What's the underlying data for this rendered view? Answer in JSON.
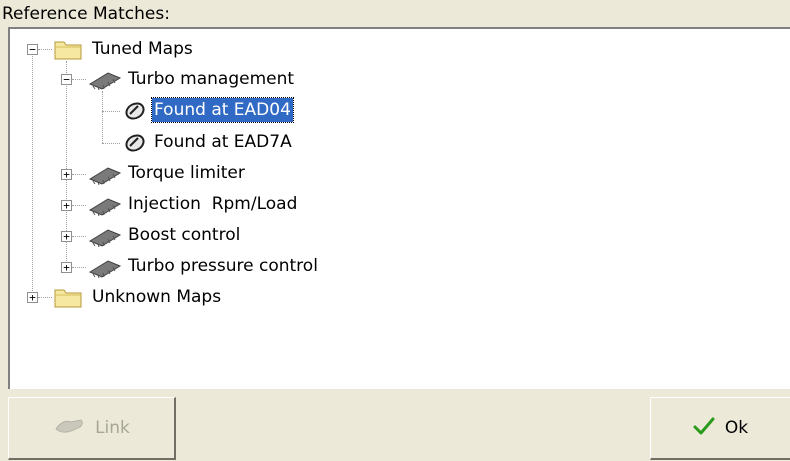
{
  "reference_label": "Reference Matches:",
  "tree": {
    "tuned_maps": "Tuned Maps",
    "turbo_management": "Turbo management",
    "found_1": "Found at EAD04",
    "found_2": "Found at EAD7A",
    "torque_limiter": "Torque limiter",
    "injection": "Injection  Rpm/Load",
    "boost_control": "Boost control",
    "turbo_pressure": "Turbo pressure control",
    "unknown_maps": "Unknown Maps"
  },
  "buttons": {
    "link": "Link",
    "ok": "Ok"
  },
  "colors": {
    "selection": "#316ac5",
    "ok_check": "#2a9a1a"
  },
  "icons": {
    "folder": "folder-icon",
    "chip": "chip-icon",
    "map_found": "map-found-icon",
    "link": "link-icon",
    "ok": "checkmark-icon"
  }
}
